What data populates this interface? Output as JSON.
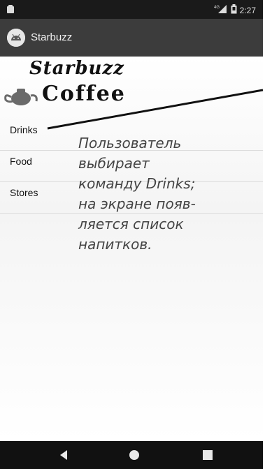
{
  "status_bar": {
    "signal_label": "4G",
    "time": "2:27",
    "icons": [
      "android-icon",
      "signal-icon",
      "battery-icon"
    ]
  },
  "app_bar": {
    "title": "Starbuzz",
    "icon": "android-icon"
  },
  "logo": {
    "line1": "Starbuzz",
    "line2": "Coffee",
    "icon": "teapot-icon"
  },
  "menu": {
    "items": [
      {
        "label": "Drinks"
      },
      {
        "label": "Food"
      },
      {
        "label": "Stores"
      }
    ]
  },
  "annotation": {
    "text": "Пользователь\nвыбирает\nкоманду Drinks;\nна экране появ-\nляется список\nнапитков."
  },
  "nav_bar": {
    "icons": [
      "back-icon",
      "home-icon",
      "recents-icon"
    ]
  },
  "colors": {
    "status_bar": "#1a1a1a",
    "app_bar": "#3c3c3c",
    "nav_bar": "#111111",
    "divider": "#dcdcdc"
  }
}
